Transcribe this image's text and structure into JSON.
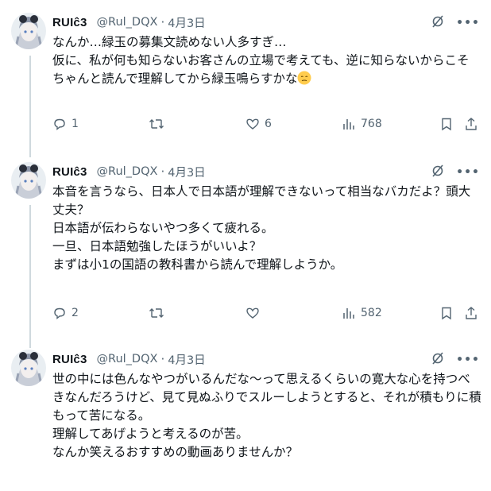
{
  "tweets": [
    {
      "display_name": "RUIĉ3",
      "handle": "@Rul_DQX",
      "separator": "·",
      "date": "4月3日",
      "text_before_emoji": "なんか…緑玉の募集文読めない人多すぎ…\n仮に、私が何も知らないお客さんの立場で考えても、逆に知らないからこそちゃんと読んで理解してから緑玉鳴らすかな",
      "emoji": "pensive-face",
      "replies": "1",
      "retweets": "",
      "likes": "6",
      "views": "768"
    },
    {
      "display_name": "RUIĉ3",
      "handle": "@Rul_DQX",
      "separator": "·",
      "date": "4月3日",
      "text": "本音を言うなら、日本人で日本語が理解できないって相当なバカだよ？頭大丈夫？\n日本語が伝わらないやつ多くて疲れる。\n一旦、日本語勉強したほうがいいよ？\nまずは小1の国語の教科書から読んで理解しようか。",
      "replies": "2",
      "retweets": "",
      "likes": "",
      "views": "582"
    },
    {
      "display_name": "RUIĉ3",
      "handle": "@Rul_DQX",
      "separator": "·",
      "date": "4月3日",
      "text": "世の中には色んなやつがいるんだな〜って思えるくらいの寛大な心を持つべきなんだろうけど、見て見ぬふりでスルーしようとすると、それが積もりに積もって苦になる。\n理解してあげようと考えるのが苦。\nなんか笑えるおすすめの動画ありませんか？"
    }
  ],
  "colors": {
    "text": "#0f1419",
    "muted": "#536471",
    "thread_line": "#cfd9de"
  }
}
